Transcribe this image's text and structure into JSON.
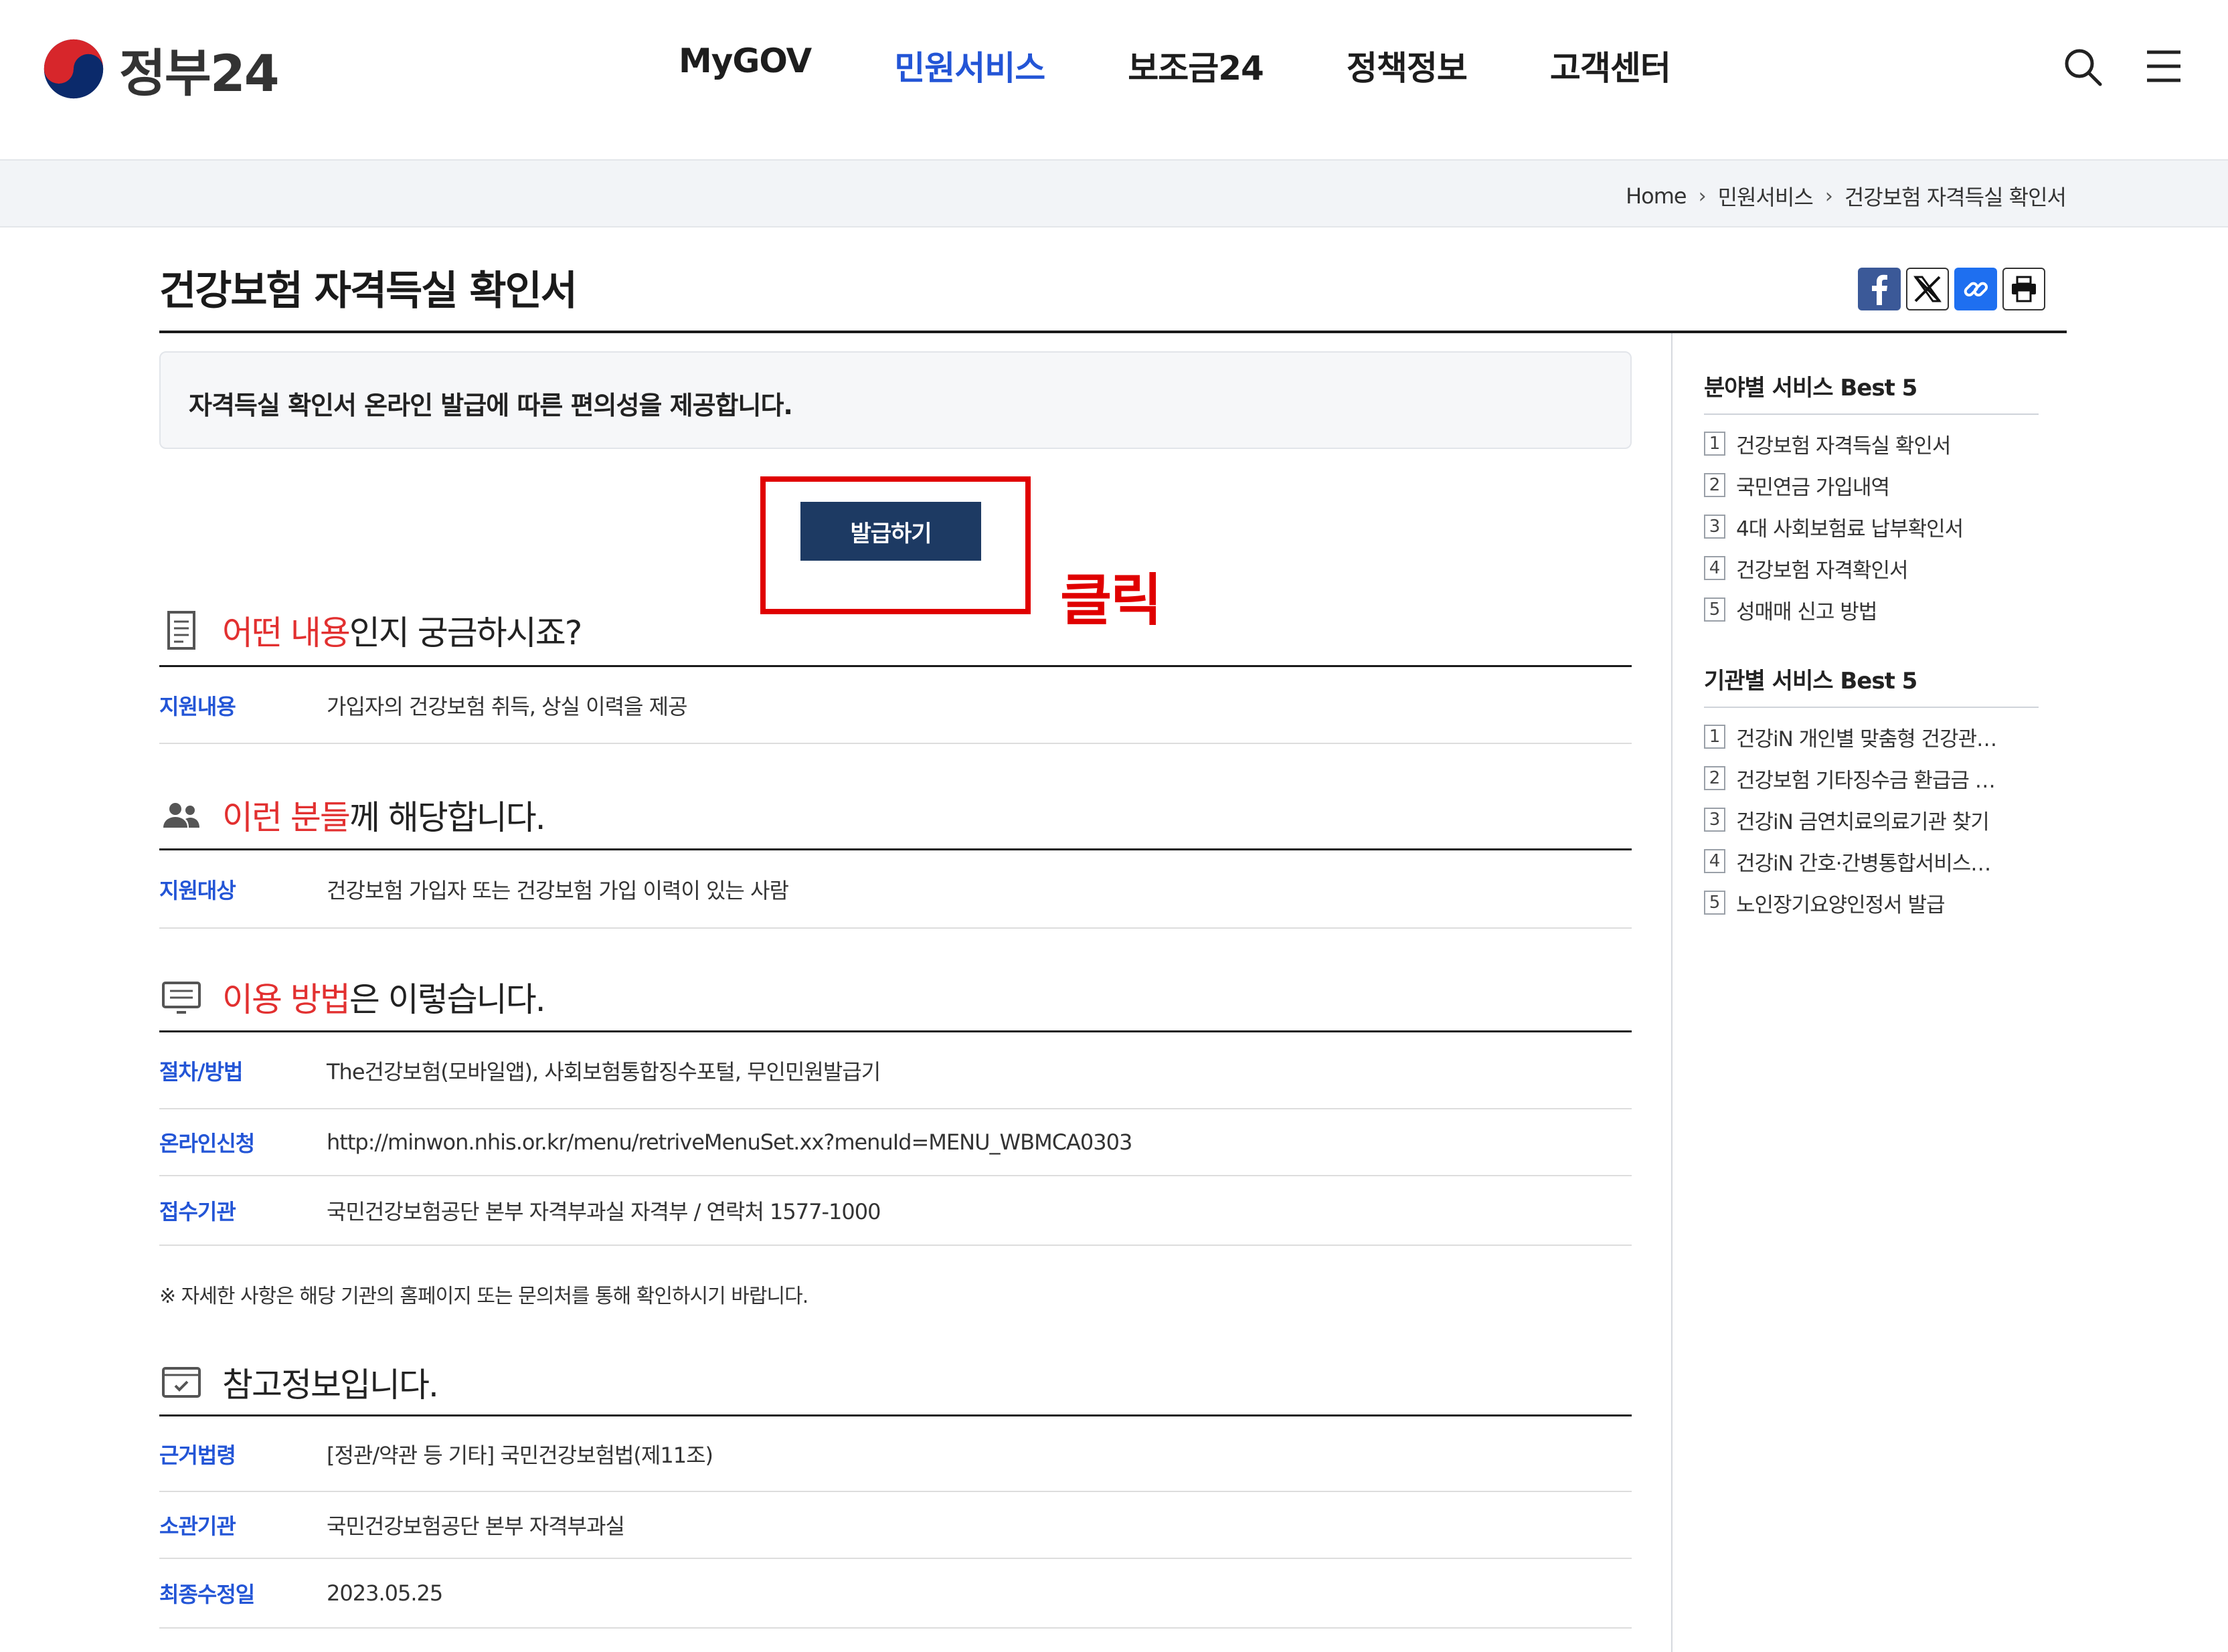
{
  "header": {
    "logo_text": "정부24",
    "nav": [
      "MyGOV",
      "민원서비스",
      "보조금24",
      "정책정보",
      "고객센터"
    ],
    "nav_active_index": 1
  },
  "breadcrumb": {
    "home": "Home",
    "level1": "민원서비스",
    "current": "건강보험 자격득실 확인서"
  },
  "page": {
    "title": "건강보험 자격득실 확인서",
    "intro": "자격득실 확인서 온라인 발급에 따른 편의성을 제공합니다.",
    "issue_button": "발급하기",
    "click_note": "클릭"
  },
  "sections": {
    "what": {
      "title_hl": "어떤 내용",
      "title_rest": "인지 궁금하시죠?",
      "rows": [
        {
          "label": "지원내용",
          "value": "가입자의 건강보험 취득, 상실 이력을 제공"
        }
      ]
    },
    "who": {
      "title_hl": "이런 분들",
      "title_rest": "께 해당합니다.",
      "rows": [
        {
          "label": "지원대상",
          "value": "건강보험 가입자 또는 건강보험 가입 이력이 있는 사람"
        }
      ]
    },
    "how": {
      "title_hl": "이용 방법",
      "title_rest": "은 이렇습니다.",
      "rows": [
        {
          "label": "절차/방법",
          "value": "The건강보험(모바일앱), 사회보험통합징수포털, 무인민원발급기"
        },
        {
          "label": "온라인신청",
          "value": "http://minwon.nhis.or.kr/menu/retriveMenuSet.xx?menuId=MENU_WBMCA0303"
        },
        {
          "label": "접수기관",
          "value": "국민건강보험공단 본부 자격부과실 자격부 / 연락처 1577-1000"
        }
      ],
      "note": "※ 자세한 사항은 해당 기관의 홈페이지 또는 문의처를 통해 확인하시기 바랍니다."
    },
    "ref": {
      "title": "참고정보입니다.",
      "rows": [
        {
          "label": "근거법령",
          "value": "[정관/약관 등 기타] 국민건강보험법(제11조)"
        },
        {
          "label": "소관기관",
          "value": "국민건강보험공단 본부 자격부과실"
        },
        {
          "label": "최종수정일",
          "value": "2023.05.25"
        }
      ]
    }
  },
  "sidebar": {
    "best_field": {
      "title": "분야별 서비스 Best 5",
      "items": [
        "건강보험 자격득실 확인서",
        "국민연금 가입내역",
        "4대 사회보험료 납부확인서",
        "건강보험 자격확인서",
        "성매매 신고 방법"
      ]
    },
    "best_org": {
      "title": "기관별 서비스 Best 5",
      "items": [
        "건강iN 개인별 맞춤형 건강관…",
        "건강보험 기타징수금 환급금 …",
        "건강iN 금연치료의료기관 찾기",
        "건강iN 간호·간병통합서비스…",
        "노인장기요양인정서 발급"
      ]
    }
  },
  "colors": {
    "accent": "#2355d6",
    "highlight": "#e00000",
    "button": "#1d3a63",
    "section_hl": "#e23030"
  },
  "icons": {
    "search": "search-icon",
    "menu": "hamburger-menu-icon",
    "facebook": "facebook-icon",
    "x": "x-twitter-icon",
    "link": "link-icon",
    "print": "print-icon",
    "what": "document-icon",
    "who": "people-icon",
    "how": "list-icon",
    "ref": "checkbox-card-icon"
  }
}
